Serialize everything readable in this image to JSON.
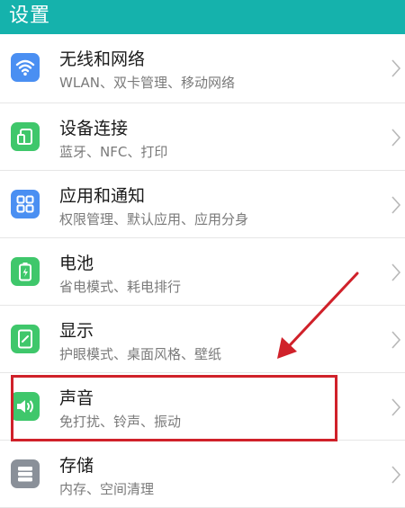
{
  "header": {
    "title": "设置",
    "background_color": "#15b2ac"
  },
  "settings": {
    "items": [
      {
        "title": "无线和网络",
        "subtitle": "WLAN、双卡管理、移动网络",
        "icon": "wifi-icon",
        "icon_color": "#4a8ff2"
      },
      {
        "title": "设备连接",
        "subtitle": "蓝牙、NFC、打印",
        "icon": "device-connect-icon",
        "icon_color": "#3fc76b"
      },
      {
        "title": "应用和通知",
        "subtitle": "权限管理、默认应用、应用分身",
        "icon": "apps-grid-icon",
        "icon_color": "#4a8ff2"
      },
      {
        "title": "电池",
        "subtitle": "省电模式、耗电排行",
        "icon": "battery-icon",
        "icon_color": "#3fc76b"
      },
      {
        "title": "显示",
        "subtitle": "护眼模式、桌面风格、壁纸",
        "icon": "display-icon",
        "icon_color": "#3fc76b"
      },
      {
        "title": "声音",
        "subtitle": "免打扰、铃声、振动",
        "icon": "speaker-icon",
        "icon_color": "#3fc76b"
      },
      {
        "title": "存储",
        "subtitle": "内存、空间清理",
        "icon": "storage-icon",
        "icon_color": "#8a9099"
      }
    ]
  },
  "annotation": {
    "highlight_color": "#d0212a",
    "highlighted_item": "声音"
  }
}
